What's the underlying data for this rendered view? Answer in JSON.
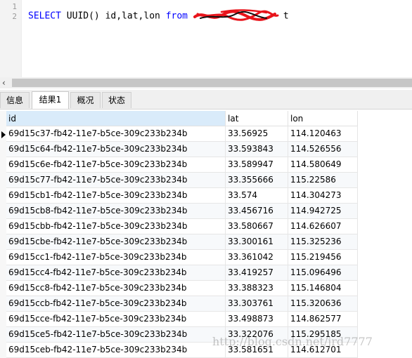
{
  "editor": {
    "line_numbers": [
      "1",
      "2"
    ],
    "code": {
      "kw_select": "SELECT",
      "middle": " UUID() id,lat,lon ",
      "kw_from": "from",
      "table_visible_tail": "t"
    }
  },
  "tabs": [
    {
      "label": "信息",
      "active": false
    },
    {
      "label": "结果1",
      "active": true
    },
    {
      "label": "概况",
      "active": false
    },
    {
      "label": "状态",
      "active": false
    }
  ],
  "grid": {
    "columns": [
      "id",
      "lat",
      "lon"
    ],
    "rows": [
      [
        "69d15c37-fb42-11e7-b5ce-309c233b234b",
        "33.56925",
        "114.120463"
      ],
      [
        "69d15c64-fb42-11e7-b5ce-309c233b234b",
        "33.593843",
        "114.526556"
      ],
      [
        "69d15c6e-fb42-11e7-b5ce-309c233b234b",
        "33.589947",
        "114.580649"
      ],
      [
        "69d15c77-fb42-11e7-b5ce-309c233b234b",
        "33.355666",
        "115.22586"
      ],
      [
        "69d15cb1-fb42-11e7-b5ce-309c233b234b",
        "33.574",
        "114.304273"
      ],
      [
        "69d15cb8-fb42-11e7-b5ce-309c233b234b",
        "33.456716",
        "114.942725"
      ],
      [
        "69d15cbb-fb42-11e7-b5ce-309c233b234b",
        "33.580667",
        "114.626607"
      ],
      [
        "69d15cbe-fb42-11e7-b5ce-309c233b234b",
        "33.300161",
        "115.325236"
      ],
      [
        "69d15cc1-fb42-11e7-b5ce-309c233b234b",
        "33.361042",
        "115.219456"
      ],
      [
        "69d15cc4-fb42-11e7-b5ce-309c233b234b",
        "33.419257",
        "115.096496"
      ],
      [
        "69d15cc8-fb42-11e7-b5ce-309c233b234b",
        "33.388323",
        "115.146804"
      ],
      [
        "69d15ccb-fb42-11e7-b5ce-309c233b234b",
        "33.303761",
        "115.320636"
      ],
      [
        "69d15cce-fb42-11e7-b5ce-309c233b234b",
        "33.498873",
        "114.862577"
      ],
      [
        "69d15ce5-fb42-11e7-b5ce-309c233b234b",
        "33.322076",
        "115.295185"
      ],
      [
        "69d15ceb-fb42-11e7-b5ce-309c233b234b",
        "33.581651",
        "114.612701"
      ]
    ]
  },
  "watermark": "http://blog.csdn.net/jrd7777",
  "colors": {
    "keyword": "#0000ff",
    "header_highlight": "#d9ebfa",
    "redaction": "#e8141b"
  }
}
